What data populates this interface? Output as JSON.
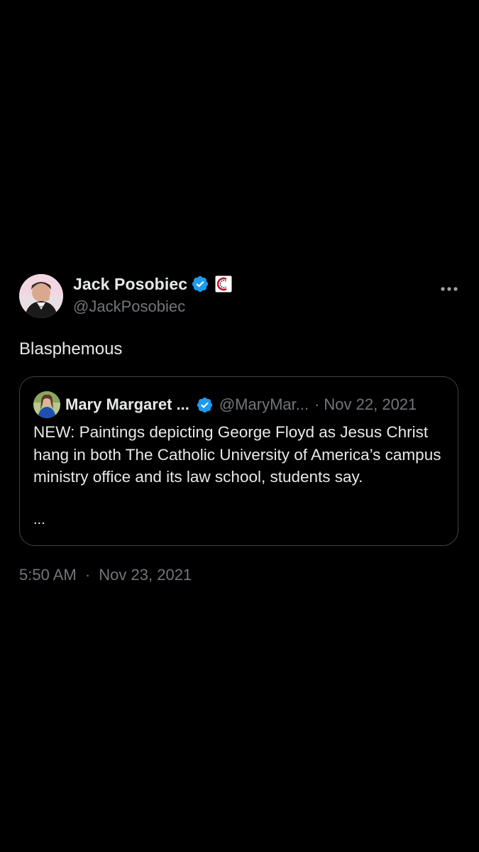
{
  "author": {
    "name": "Jack Posobiec",
    "handle": "@JackPosobiec"
  },
  "tweet": {
    "text": "Blasphemous",
    "time": "5:50 AM",
    "separator": "·",
    "date": "Nov 23, 2021"
  },
  "quoted_tweet": {
    "name": "Mary Margaret ...",
    "handle": "@MaryMar...",
    "separator": "·",
    "date": "Nov 22, 2021",
    "text": "NEW: Paintings depicting George Floyd as Jesus Christ hang in both The Catholic University of America’s campus ministry office and its law school, students say.",
    "ellipsis": "..."
  },
  "icons": {
    "verified": "verified-badge-icon",
    "affiliate": "affiliate-badge-icon",
    "more": "more-options-icon"
  },
  "colors": {
    "background": "#000000",
    "primary_text": "#e7e9ea",
    "secondary_text": "#71767b",
    "verified_blue": "#1d9bf0",
    "card_border": "#3e4144"
  }
}
